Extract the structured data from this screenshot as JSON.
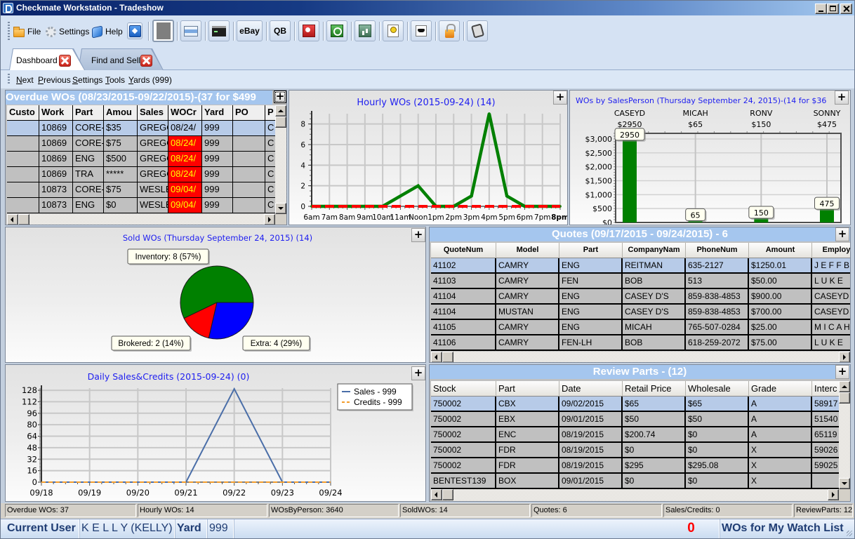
{
  "window": {
    "title": "Checkmate Workstation - Tradeshow",
    "controls": [
      "minimize-icon",
      "maximize-icon",
      "close-icon"
    ]
  },
  "toolbar": {
    "menus": [
      {
        "label": "File",
        "icon": "folder-icon"
      },
      {
        "label": "Settings",
        "icon": "gear-icon"
      },
      {
        "label": "Help",
        "icon": "help-book-icon"
      }
    ],
    "buttons": [
      {
        "icon": "compass-icon"
      },
      {
        "icon": "stop-square-icon",
        "pressed": true
      },
      {
        "icon": "monitor-icon"
      },
      {
        "icon": "terminal-icon"
      },
      {
        "label": "eBay"
      },
      {
        "label": "QB"
      },
      {
        "icon": "red-tool-icon"
      },
      {
        "icon": "green-gear-icon"
      },
      {
        "icon": "bar-chart-icon"
      },
      {
        "icon": "key-icon"
      },
      {
        "icon": "graduation-cap-icon"
      },
      {
        "icon": "lock-icon"
      },
      {
        "icon": "scroll-icon"
      }
    ]
  },
  "tabs": [
    {
      "label": "Dashboard",
      "active": true
    },
    {
      "label": "Find and Sell",
      "active": false
    }
  ],
  "subnav": {
    "items": [
      "Next",
      "Previous",
      "Settings",
      "Tools",
      "Yards (999)"
    ]
  },
  "panels": {
    "expand_label": "+"
  },
  "colors": {
    "selected_row": "#b7cbe8",
    "row": "#c0c0c0",
    "late_cell": "#ff0000",
    "late_text": "#ffff00",
    "panel_header": "#a5c6ee",
    "chart_title": "#1e1ef0",
    "watch_count": "#ff0000"
  },
  "overdue": {
    "title": "Overdue WOs (08/23/2015-09/22/2015)-(37 for $499",
    "columns": [
      "Custo",
      "Work",
      "Part",
      "Amou",
      "Sales",
      "WOCr",
      "Yard",
      "PO",
      "P"
    ],
    "rows": [
      {
        "selected": true,
        "late": true,
        "cells": [
          "",
          "10869",
          "CORE-",
          "$35",
          "GREGC",
          "08/24/",
          "999",
          "",
          "C"
        ]
      },
      {
        "selected": false,
        "late": true,
        "cells": [
          "",
          "10869",
          "CORE-",
          "$75",
          "GREGC",
          "08/24/",
          "999",
          "",
          "C"
        ]
      },
      {
        "selected": false,
        "late": true,
        "cells": [
          "",
          "10869",
          "ENG",
          "$500",
          "GREGC",
          "08/24/",
          "999",
          "",
          "C"
        ]
      },
      {
        "selected": false,
        "late": true,
        "cells": [
          "",
          "10869",
          "TRA",
          "*****",
          "GREGC",
          "08/24/",
          "999",
          "",
          "C"
        ]
      },
      {
        "selected": false,
        "late": true,
        "cells": [
          "",
          "10873",
          "CORE-",
          "$75",
          "WESLE",
          "09/04/",
          "999",
          "",
          "C"
        ]
      },
      {
        "selected": false,
        "late": true,
        "cells": [
          "",
          "10873",
          "ENG",
          "$0",
          "WESLE",
          "09/04/",
          "999",
          "",
          "C"
        ]
      }
    ]
  },
  "quotes": {
    "title": "Quotes (09/17/2015 - 09/24/2015) - 6",
    "columns": [
      "QuoteNum",
      "Model",
      "Part",
      "CompanyNam",
      "PhoneNum",
      "Amount",
      "Employ"
    ],
    "rows": [
      {
        "selected": true,
        "cells": [
          "41102",
          "CAMRY",
          "ENG",
          "REITMAN",
          "635-2127",
          "$1250.01",
          "J E F F B"
        ]
      },
      {
        "selected": false,
        "cells": [
          "41103",
          "CAMRY",
          "FEN",
          "BOB",
          "513",
          "$50.00",
          "L U K E"
        ]
      },
      {
        "selected": false,
        "cells": [
          "41104",
          "CAMRY",
          "ENG",
          "CASEY D'S",
          "859-838-4853",
          "$900.00",
          "CASEYD"
        ]
      },
      {
        "selected": false,
        "cells": [
          "41104",
          "MUSTAN",
          "ENG",
          "CASEY D'S",
          "859-838-4853",
          "$700.00",
          "CASEYD"
        ]
      },
      {
        "selected": false,
        "cells": [
          "41105",
          "CAMRY",
          "ENG",
          "MICAH",
          "765-507-0284",
          "$25.00",
          "M I C A H"
        ]
      },
      {
        "selected": false,
        "cells": [
          "41106",
          "CAMRY",
          "FEN-LH",
          "BOB",
          "618-259-2072",
          "$75.00",
          "L U K E"
        ]
      }
    ]
  },
  "review_parts": {
    "title": "Review Parts - (12)",
    "columns": [
      "Stock",
      "Part",
      "Date",
      "Retail Price",
      "Wholesale",
      "Grade",
      "Interc"
    ],
    "rows": [
      {
        "selected": true,
        "cells": [
          "750002",
          "CBX",
          "09/02/2015",
          "$65",
          "$65",
          "A",
          "58917"
        ]
      },
      {
        "selected": false,
        "cells": [
          "750002",
          "EBX",
          "09/01/2015",
          "$50",
          "$50",
          "A",
          "51540"
        ]
      },
      {
        "selected": false,
        "cells": [
          "750002",
          "ENC",
          "08/19/2015",
          "$200.74",
          "$0",
          "A",
          "65119"
        ]
      },
      {
        "selected": false,
        "cells": [
          "750002",
          "FDR",
          "08/19/2015",
          "$0",
          "$0",
          "X",
          "59026"
        ]
      },
      {
        "selected": false,
        "cells": [
          "750002",
          "FDR",
          "08/19/2015",
          "$295",
          "$295.08",
          "X",
          "59025"
        ]
      },
      {
        "selected": false,
        "cells": [
          "BENTEST139",
          "BOX",
          "09/01/2015",
          "$0",
          "$0",
          "X",
          ""
        ]
      }
    ]
  },
  "status_bar": {
    "items": [
      "Overdue WOs: 37",
      "Hourly WOs: 14",
      "WOsByPerson: 3640",
      "SoldWOs: 14",
      "Quotes: 6",
      "Sales/Credits: 0",
      "ReviewParts: 12"
    ]
  },
  "user_bar": {
    "current_user_label": "Current User",
    "current_user": "K E L L Y (KELLY)",
    "yard_label": "Yard",
    "yard": "999",
    "watch_count": "0",
    "watch_label": "WOs for My Watch List"
  },
  "chart_data": [
    {
      "type": "line",
      "title": "Hourly WOs (2015-09-24) (14)",
      "categories": [
        "6am",
        "7am",
        "8am",
        "9am",
        "10am",
        "11am",
        "Noon",
        "1pm",
        "2pm",
        "3pm",
        "4pm",
        "5pm",
        "6pm",
        "7pm",
        "8pm"
      ],
      "highlight_category": "8pm",
      "series": [
        {
          "color": "#008000",
          "dashed": false,
          "values": [
            0,
            0,
            0,
            0,
            0,
            1,
            2,
            0,
            0,
            1,
            9,
            1,
            0,
            0,
            0
          ]
        },
        {
          "color": "#ff0000",
          "dashed": true,
          "values": [
            0,
            0,
            0,
            0,
            0,
            0,
            0,
            0,
            0,
            0,
            0,
            0,
            0,
            0,
            0
          ]
        }
      ],
      "yticks": [
        0,
        2,
        4,
        6,
        8
      ],
      "ylim": [
        0,
        9
      ],
      "xlabel": "",
      "ylabel": "",
      "grid": true
    },
    {
      "type": "bar",
      "title": "WOs by SalesPerson (Thursday  September 24, 2015)-(14 for $36",
      "categories": [
        "CASEYD",
        "MICAH",
        "RONV",
        "SONNY"
      ],
      "category_totals": [
        "$2950",
        "$65",
        "$150",
        "$475"
      ],
      "values": [
        2950,
        65,
        150,
        475
      ],
      "data_labels": [
        "2950",
        "65",
        "150",
        "475"
      ],
      "yticks": [
        0,
        500,
        1000,
        1500,
        2000,
        2500,
        3000
      ],
      "ytick_labels": [
        "$0",
        "$500",
        "$1,000",
        "$1,500",
        "$2,000",
        "$2,500",
        "$3,000"
      ],
      "ylim": [
        0,
        3200
      ],
      "bar_color": "#008000",
      "xlabel": "",
      "ylabel": "",
      "grid": true
    },
    {
      "type": "pie",
      "title": "Sold WOs (Thursday  September 24, 2015) (14)",
      "slices": [
        {
          "label": "Inventory",
          "value": 8,
          "percent": 57,
          "color": "#008000",
          "text": "Inventory: 8  (57%)"
        },
        {
          "label": "Brokered",
          "value": 2,
          "percent": 14,
          "color": "#ff0000",
          "text": "Brokered: 2  (14%)"
        },
        {
          "label": "Extra",
          "value": 4,
          "percent": 29,
          "color": "#0000ff",
          "text": "Extra: 4  (29%)"
        }
      ]
    },
    {
      "type": "line",
      "title": "Daily Sales&Credits (2015-09-24) (0)",
      "categories": [
        "09/18",
        "09/19",
        "09/20",
        "09/21",
        "09/22",
        "09/23",
        "09/24"
      ],
      "series": [
        {
          "name": "Sales - 999",
          "color": "#4a6ea8",
          "dashed": false,
          "values": [
            0,
            0,
            0,
            0,
            130,
            0,
            0
          ]
        },
        {
          "name": "Credits - 999",
          "color": "#f39c2b",
          "dashed": true,
          "values": [
            0,
            0,
            0,
            0,
            0,
            0,
            0
          ]
        }
      ],
      "yticks": [
        0,
        16,
        32,
        48,
        64,
        80,
        96,
        112,
        128
      ],
      "ylim": [
        0,
        131
      ],
      "legend": "top-right",
      "xlabel": "",
      "ylabel": "",
      "grid": true
    }
  ]
}
